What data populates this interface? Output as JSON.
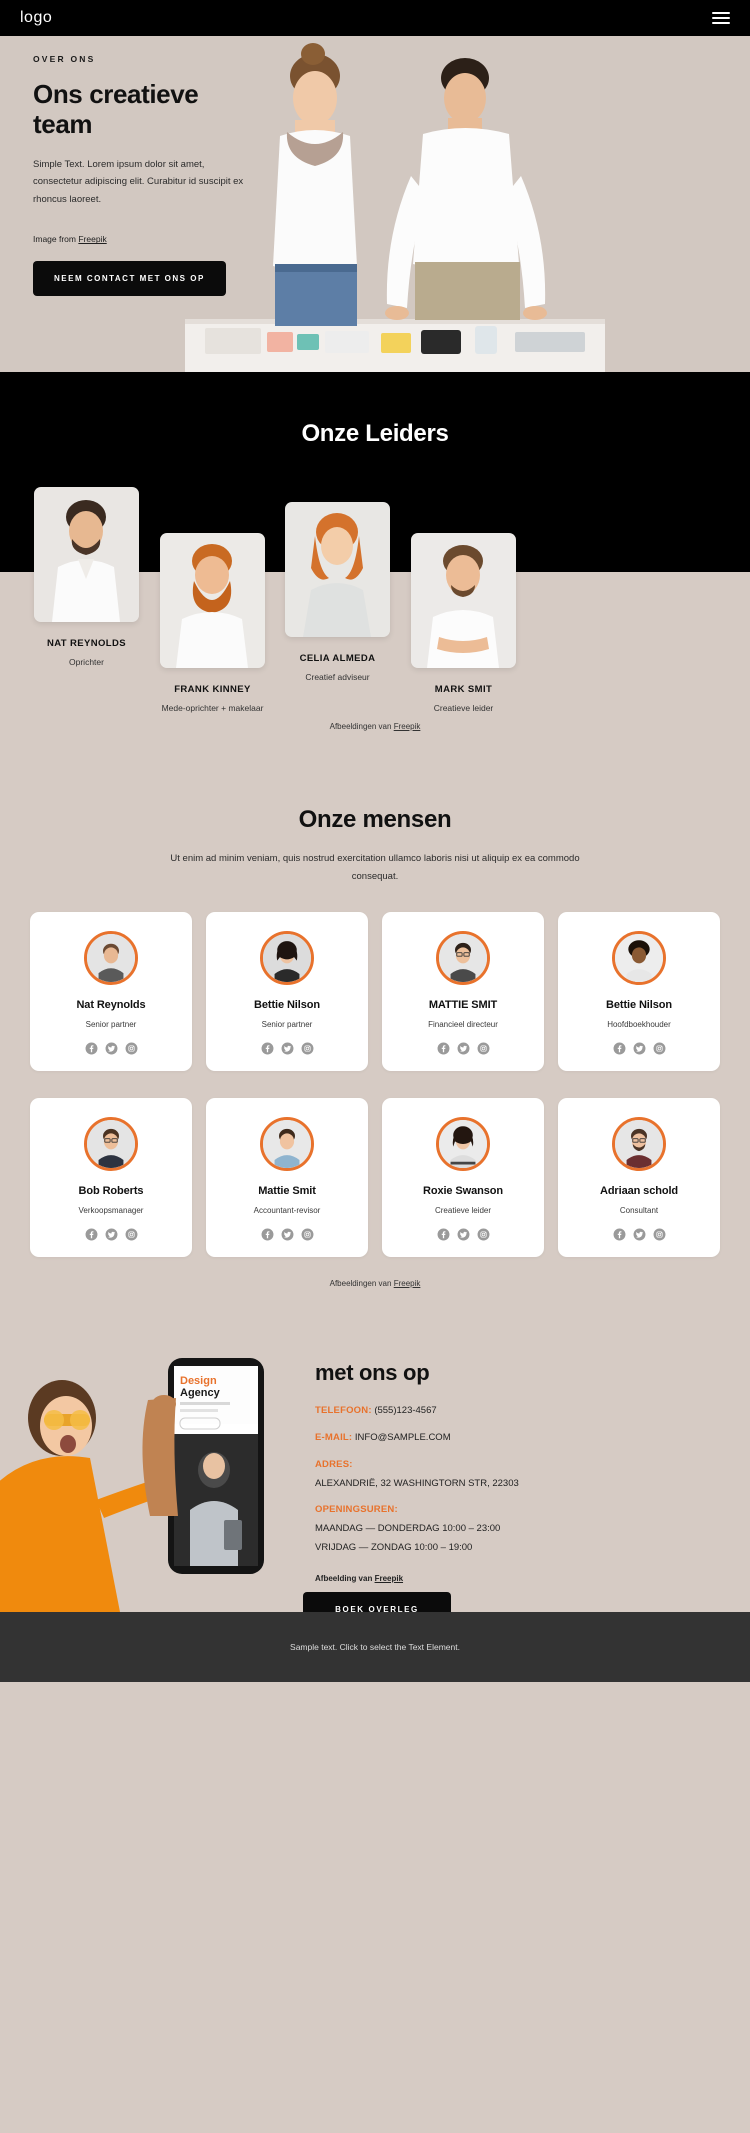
{
  "header": {
    "logo": "logo",
    "menu_icon": "hamburger-menu"
  },
  "hero": {
    "eyebrow": "OVER ONS",
    "title": "Ons creatieve team",
    "paragraph": "Simple Text. Lorem ipsum dolor sit amet, consectetur adipiscing elit. Curabitur id suscipit ex rhoncus laoreet.",
    "credit_prefix": "Image from ",
    "credit_link": "Freepik",
    "cta": "NEEM CONTACT MET ONS OP"
  },
  "leaders": {
    "title": "Onze Leiders",
    "credit_prefix": "Afbeeldingen van ",
    "credit_link": "Freepik",
    "items": [
      {
        "name": "NAT REYNOLDS",
        "role": "Oprichter"
      },
      {
        "name": "FRANK KINNEY",
        "role": "Mede-oprichter + makelaar"
      },
      {
        "name": "CELIA ALMEDA",
        "role": "Creatief adviseur"
      },
      {
        "name": "MARK SMIT",
        "role": "Creatieve leider"
      }
    ]
  },
  "people": {
    "title": "Onze mensen",
    "subtitle": "Ut enim ad minim veniam, quis nostrud exercitation ullamco laboris nisi ut aliquip ex ea commodo consequat.",
    "credit_prefix": "Afbeeldingen van ",
    "credit_link": "Freepik",
    "social_icons": [
      "facebook-icon",
      "twitter-icon",
      "instagram-icon"
    ],
    "accent_color": "#e8722c",
    "members": [
      {
        "name": "Nat Reynolds",
        "role": "Senior partner"
      },
      {
        "name": "Bettie Nilson",
        "role": "Senior partner"
      },
      {
        "name": "MATTIE SMIT",
        "role": "Financieel directeur"
      },
      {
        "name": "Bettie Nilson",
        "role": "Hoofdboekhouder"
      },
      {
        "name": "Bob Roberts",
        "role": "Verkoopsmanager"
      },
      {
        "name": "Mattie Smit",
        "role": "Accountant-revisor"
      },
      {
        "name": "Roxie Swanson",
        "role": "Creatieve leider"
      },
      {
        "name": "Adriaan schold",
        "role": "Consultant"
      }
    ]
  },
  "contact": {
    "title": "met ons op",
    "phone_label": "TELEFOON:",
    "phone_value": "(555)123-4567",
    "email_label": "E-MAIL:",
    "email_value": "INFO@SAMPLE.COM",
    "address_label": "ADRES:",
    "address_value": "ALEXANDRIË, 32 WASHINGTORN STR, 22303",
    "hours_label": "OPENINGSUREN:",
    "hours_line1": "MAANDAG — DONDERDAG 10:00 – 23:00",
    "hours_line2": "VRIJDAG — ZONDAG 10:00 – 19:00",
    "credit_prefix": "Afbeelding van ",
    "credit_link": "Freepik",
    "cta": "BOEK OVERLEG"
  },
  "footer": {
    "text": "Sample text. Click to select the Text Element."
  }
}
